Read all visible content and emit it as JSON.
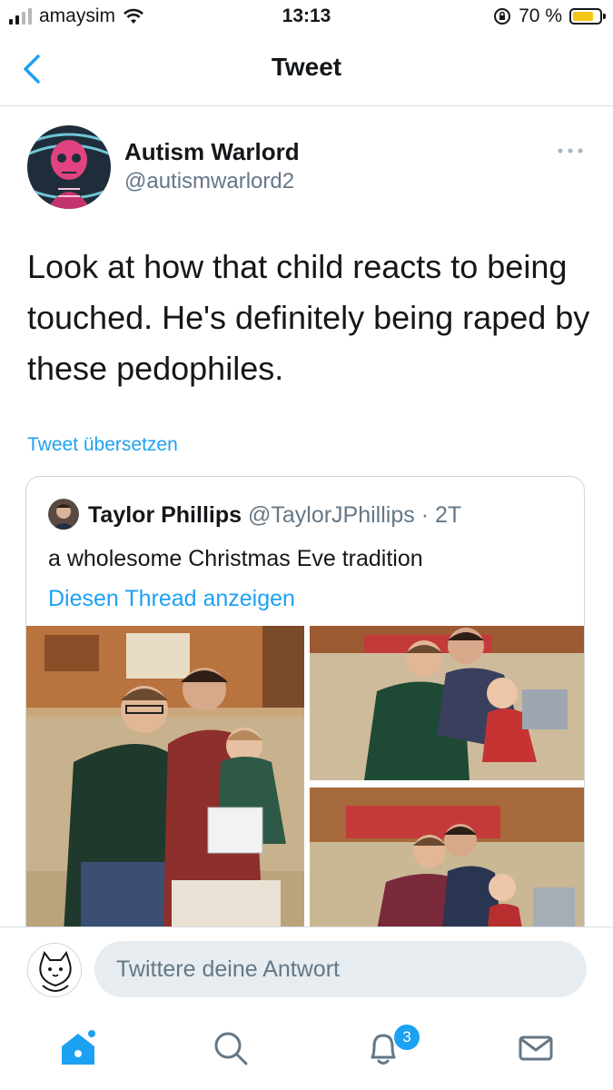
{
  "status_bar": {
    "carrier": "amaysim",
    "time": "13:13",
    "battery": "70 %",
    "battery_level": 0.7
  },
  "header": {
    "title": "Tweet"
  },
  "tweet": {
    "author_name": "Autism Warlord",
    "author_handle": "@autismwarlord2",
    "text": "Look at how that child reacts to being touched. He's definitely being raped by these pedophiles.",
    "translate_link": "Tweet übersetzen"
  },
  "quoted_tweet": {
    "author_name": "Taylor Phillips",
    "author_handle": "@TaylorJPhillips",
    "time_ago": "· 2T",
    "text": "a wholesome Christmas Eve tradition",
    "thread_link": "Diesen Thread anzeigen"
  },
  "reply": {
    "placeholder": "Twittere deine Antwort"
  },
  "tabbar": {
    "notifications_count": "3"
  },
  "colors": {
    "accent": "#1da1f2",
    "secondary_text": "#657786",
    "divider": "#d8dde1",
    "reply_bg": "#e6ecf0"
  }
}
